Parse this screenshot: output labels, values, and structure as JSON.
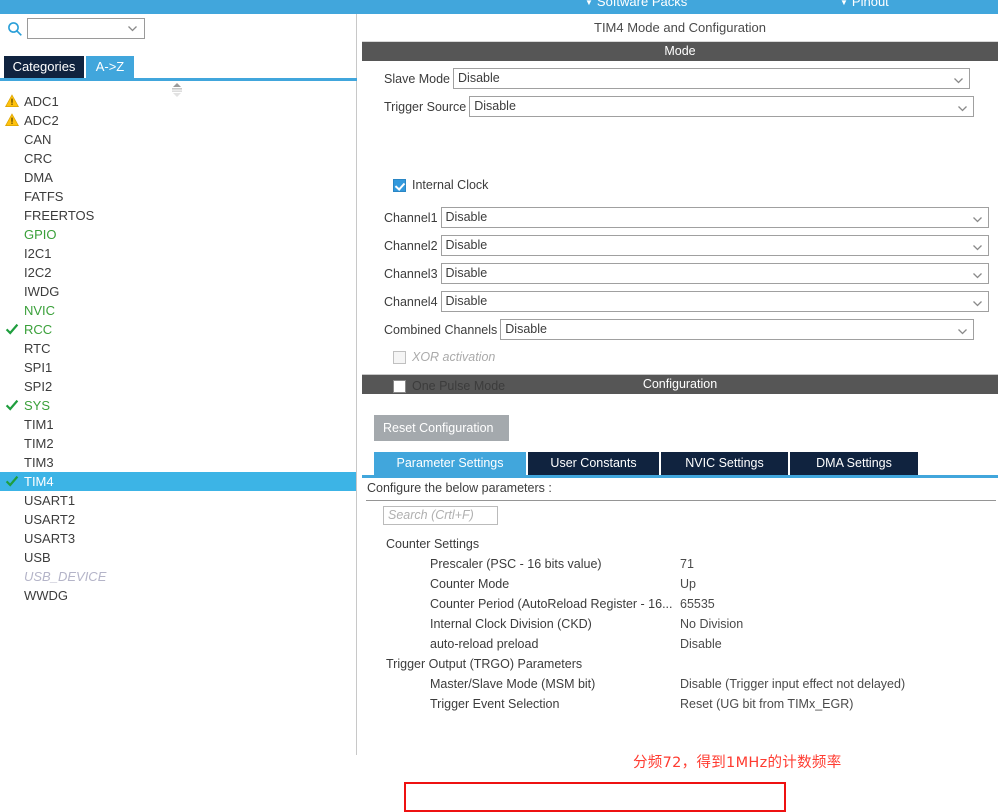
{
  "app": {
    "menu": [
      {
        "label": "Software Packs",
        "icon": "caret-down-icon"
      },
      {
        "label": "Pinout",
        "icon": "caret-down-icon"
      }
    ]
  },
  "sidebar": {
    "search": {
      "value": "",
      "placeholder": ""
    },
    "tabs": [
      {
        "label": "Categories",
        "active": false
      },
      {
        "label": "A->Z",
        "active": true
      }
    ],
    "items": [
      {
        "label": "ADC1",
        "state": "warning"
      },
      {
        "label": "ADC2",
        "state": "warning"
      },
      {
        "label": "CAN",
        "state": "none"
      },
      {
        "label": "CRC",
        "state": "none"
      },
      {
        "label": "DMA",
        "state": "none"
      },
      {
        "label": "FATFS",
        "state": "none"
      },
      {
        "label": "FREERTOS",
        "state": "none"
      },
      {
        "label": "GPIO",
        "state": "configured"
      },
      {
        "label": "I2C1",
        "state": "none"
      },
      {
        "label": "I2C2",
        "state": "none"
      },
      {
        "label": "IWDG",
        "state": "none"
      },
      {
        "label": "NVIC",
        "state": "configured"
      },
      {
        "label": "RCC",
        "state": "ok"
      },
      {
        "label": "RTC",
        "state": "none"
      },
      {
        "label": "SPI1",
        "state": "none"
      },
      {
        "label": "SPI2",
        "state": "none"
      },
      {
        "label": "SYS",
        "state": "ok"
      },
      {
        "label": "TIM1",
        "state": "none"
      },
      {
        "label": "TIM2",
        "state": "none"
      },
      {
        "label": "TIM3",
        "state": "none"
      },
      {
        "label": "TIM4",
        "state": "ok",
        "selected": true
      },
      {
        "label": "USART1",
        "state": "none"
      },
      {
        "label": "USART2",
        "state": "none"
      },
      {
        "label": "USART3",
        "state": "none"
      },
      {
        "label": "USB",
        "state": "none"
      },
      {
        "label": "USB_DEVICE",
        "state": "disabled"
      },
      {
        "label": "WWDG",
        "state": "none"
      }
    ]
  },
  "main": {
    "title": "TIM4 Mode and Configuration",
    "mode": {
      "header": "Mode",
      "fields": [
        {
          "label": "Slave Mode",
          "value": "Disable"
        },
        {
          "label": "Trigger Source",
          "value": "Disable"
        },
        {
          "label": "Channel1",
          "value": "Disable"
        },
        {
          "label": "Channel2",
          "value": "Disable"
        },
        {
          "label": "Channel3",
          "value": "Disable"
        },
        {
          "label": "Channel4",
          "value": "Disable"
        },
        {
          "label": "Combined Channels",
          "value": "Disable"
        }
      ],
      "checkboxes": [
        {
          "label": "Internal Clock",
          "checked": true,
          "enabled": true
        },
        {
          "label": "XOR activation",
          "checked": false,
          "enabled": false
        },
        {
          "label": "One Pulse Mode",
          "checked": false,
          "enabled": true
        }
      ]
    },
    "configuration": {
      "header": "Configuration",
      "reset_label": "Reset Configuration",
      "tabs": [
        {
          "label": "Parameter Settings",
          "active": true
        },
        {
          "label": "User Constants",
          "active": false
        },
        {
          "label": "NVIC Settings",
          "active": false
        },
        {
          "label": "DMA Settings",
          "active": false
        }
      ],
      "note": "Configure the below parameters :",
      "search_placeholder": "Search (Crtl+F)",
      "groups": [
        {
          "title": "Counter Settings",
          "rows": [
            {
              "name": "Prescaler (PSC - 16 bits value)",
              "value": "71",
              "highlighted": true
            },
            {
              "name": "Counter Mode",
              "value": "Up"
            },
            {
              "name": "Counter Period (AutoReload Register - 16...",
              "value": "65535"
            },
            {
              "name": "Internal Clock Division (CKD)",
              "value": "No Division"
            },
            {
              "name": "auto-reload preload",
              "value": "Disable"
            }
          ]
        },
        {
          "title": "Trigger Output (TRGO) Parameters",
          "rows": [
            {
              "name": "Master/Slave Mode (MSM bit)",
              "value": "Disable (Trigger input effect not delayed)"
            },
            {
              "name": "Trigger Event Selection",
              "value": "Reset (UG bit from TIMx_EGR)"
            }
          ]
        }
      ]
    }
  },
  "annotations": {
    "note_text": "分频72，得到1MHz的计数频率",
    "color": "#ff3b30"
  },
  "colors": {
    "accent_blue": "#41a6dc",
    "tab_navy": "#10233f",
    "section_grey": "#565656",
    "selected_row": "#3cb4e6",
    "ok_green": "#3aa03a",
    "warning_yellow": "#ffc20e",
    "annotation_red": "#ee1111"
  }
}
